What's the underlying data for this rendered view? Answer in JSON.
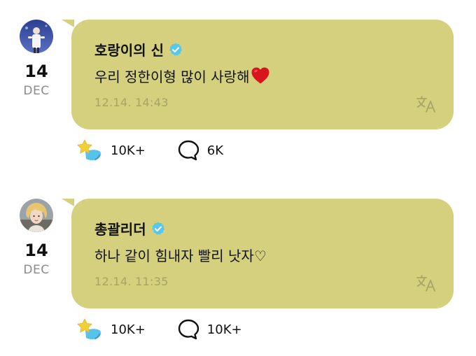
{
  "posts": [
    {
      "author": "호랑이의 신",
      "verified": true,
      "day": "14",
      "month": "DEC",
      "message": "우리 정한이형 많이 사랑해",
      "message_emoji": "red-heart",
      "time": "12.14. 14:43",
      "likes": "10K+",
      "comments": "6K"
    },
    {
      "author": "총괄리더",
      "verified": true,
      "day": "14",
      "month": "DEC",
      "message": "하나 같이 힘내자 빨리 낫자♡",
      "time": "12.14. 11:35",
      "likes": "10K+",
      "comments": "10K+"
    }
  ],
  "colors": {
    "bubble": "#d4d07e",
    "time_text": "#a6a363",
    "verified_badge": "#5bc7e8",
    "star": "#f2cf37",
    "star_trail": "#58c3ea"
  },
  "icons": [
    "verified-icon",
    "translate-icon",
    "star-like-icon",
    "comment-icon",
    "heart-emoji-icon"
  ]
}
